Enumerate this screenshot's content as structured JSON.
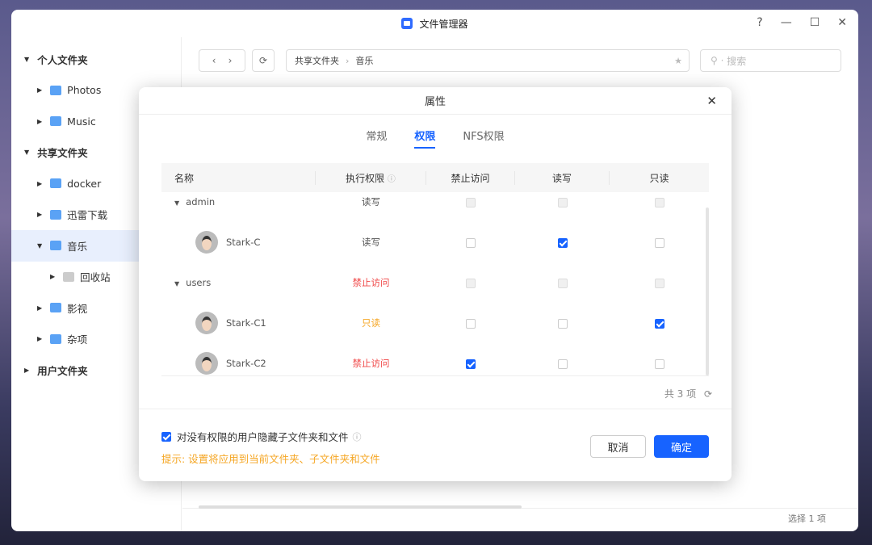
{
  "window": {
    "title": "文件管理器",
    "help": "?",
    "minimize": "—",
    "maximize": "☐",
    "close": "✕"
  },
  "sidebar": {
    "items": [
      {
        "label": "个人文件夹",
        "type": "header"
      },
      {
        "label": "Photos"
      },
      {
        "label": "Music"
      },
      {
        "label": "共享文件夹",
        "type": "header"
      },
      {
        "label": "docker"
      },
      {
        "label": "迅雷下载"
      },
      {
        "label": "音乐",
        "selected": true
      },
      {
        "label": "回收站"
      },
      {
        "label": "影视"
      },
      {
        "label": "杂项"
      },
      {
        "label": "用户文件夹",
        "type": "header"
      }
    ]
  },
  "toolbar": {
    "breadcrumb": [
      "共享文件夹",
      "音乐"
    ],
    "search_placeholder": "搜索"
  },
  "dialog": {
    "title": "属性",
    "tabs": [
      "常规",
      "权限",
      "NFS权限"
    ],
    "active_tab": "权限",
    "columns": [
      "名称",
      "执行权限",
      "禁止访问",
      "读写",
      "只读"
    ],
    "rows": [
      {
        "name": "admin",
        "perm": "读写",
        "deny": false,
        "rw": true,
        "ro": false,
        "group": true
      },
      {
        "name": "Stark-C",
        "perm": "读写",
        "deny": false,
        "rw": true,
        "ro": false
      },
      {
        "name": "users",
        "perm": "禁止访问",
        "deny": false,
        "rw": false,
        "ro": false,
        "group": true
      },
      {
        "name": "Stark-C1",
        "perm": "只读",
        "deny": false,
        "rw": false,
        "ro": true
      },
      {
        "name": "Stark-C2",
        "perm": "禁止访问",
        "deny": true,
        "rw": false,
        "ro": false
      }
    ],
    "count": "共 3 项",
    "hide_option": "对没有权限的用户隐藏子文件夹和文件",
    "hint": "提示: 设置将应用到当前文件夹、子文件夹和文件",
    "cancel": "取消",
    "ok": "确定"
  },
  "colors": {
    "accent": "#1763ff",
    "deny": "#f04848",
    "readonly": "#f5a623"
  },
  "status": {
    "text": "选择 1 项"
  }
}
